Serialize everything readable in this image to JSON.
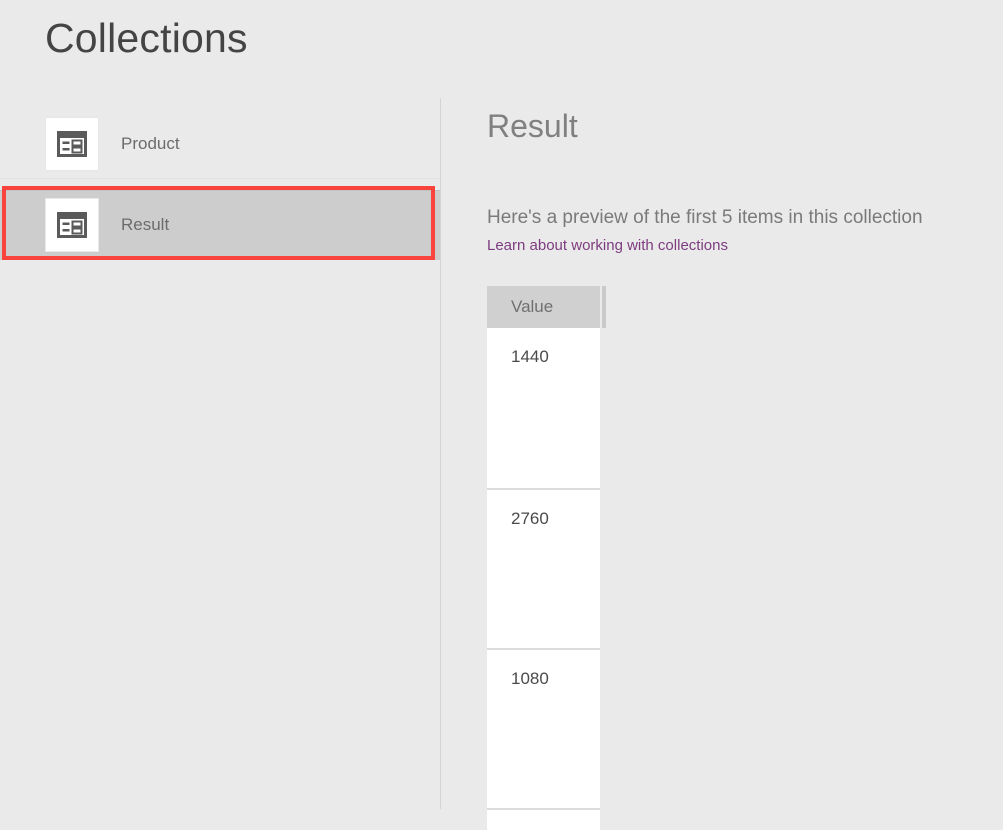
{
  "page": {
    "title": "Collections",
    "background_color": "#eaeaea"
  },
  "sidebar": {
    "items": [
      {
        "label": "Product",
        "icon": "collection-table-icon",
        "selected": false
      },
      {
        "label": "Result",
        "icon": "collection-table-icon",
        "selected": true
      }
    ],
    "selection_highlight_color": "#f8443c",
    "selected_row_color": "#cdcdcd"
  },
  "detail": {
    "title": "Result",
    "preview_note": "Here's a preview of the first 5 items in this collection",
    "learn_link": "Learn about working with collections",
    "link_color": "#7d3c7f"
  },
  "table": {
    "columns": [
      "Value"
    ],
    "header_background": "#d0d0d0",
    "rows": [
      {
        "Value": "1440"
      },
      {
        "Value": "2760"
      },
      {
        "Value": "1080"
      }
    ]
  }
}
